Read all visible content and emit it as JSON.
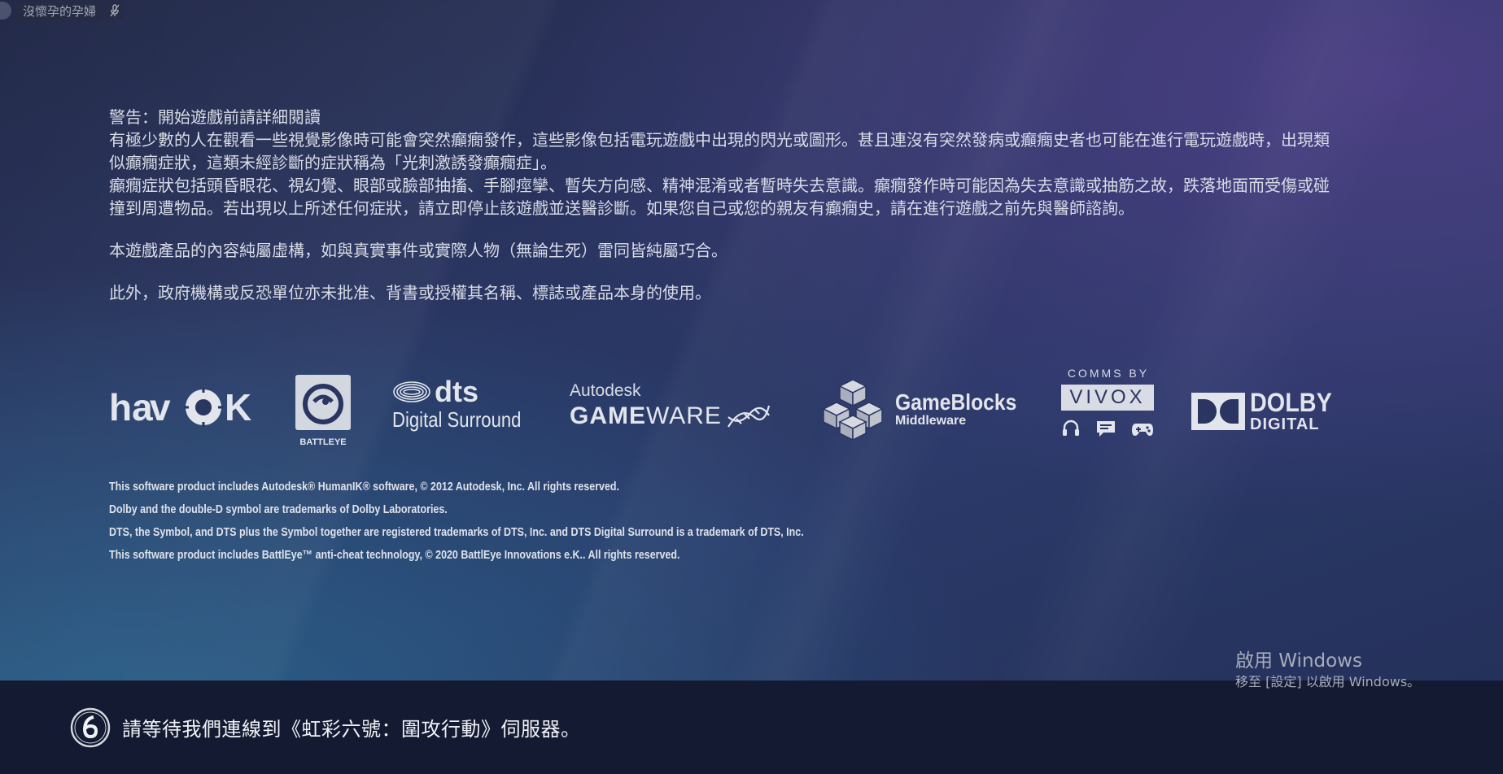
{
  "overlay": {
    "username": "沒懷孕的孕婦",
    "mute_icon": "microphone-muted-icon"
  },
  "warning": {
    "title": "警告：開始遊戲前請詳細閱讀",
    "para1": "有極少數的人在觀看一些視覺影像時可能會突然癲癇發作，這些影像包括電玩遊戲中出現的閃光或圖形。甚且連沒有突然發病或癲癇史者也可能在進行電玩遊戲時，出現類似癲癇症狀，這類未經診斷的症狀稱為「光刺激誘發癲癇症」。",
    "para2": "癲癇症狀包括頭昏眼花、視幻覺、眼部或臉部抽搐、手腳痙攣、暫失方向感、精神混淆或者暫時失去意識。癲癇發作時可能因為失去意識或抽筋之故，跌落地面而受傷或碰撞到周遭物品。若出現以上所述任何症狀，請立即停止該遊戲並送醫診斷。如果您自己或您的親友有癲癇史，請在進行遊戲之前先與醫師諮詢。",
    "para3": "本遊戲產品的內容純屬虛構，如與真實事件或實際人物（無論生死）雷同皆純屬巧合。",
    "para4": "此外，政府機構或反恐單位亦未批准、背書或授權其名稱、標誌或產品本身的使用。"
  },
  "logos": {
    "havok": "havok",
    "battleye": "BATTLEYE",
    "dts_brand": "dts",
    "dts_sub": "Digital Surround",
    "autodesk_top": "Autodesk",
    "autodesk_main_a": "GAME",
    "autodesk_main_b": "WARE",
    "gameblocks_main": "GameBlocks",
    "gameblocks_sub": "Middleware",
    "vivox_top": "COMMS BY",
    "vivox_main": "VIVOX",
    "dolby_main": "DOLBY",
    "dolby_sub": "DIGITAL"
  },
  "legal": [
    "This software product includes Autodesk® HumanIK® software, © 2012 Autodesk, Inc. All rights reserved.",
    "Dolby and the double-D symbol are trademarks of Dolby Laboratories.",
    "DTS, the Symbol, and DTS plus the Symbol together are registered trademarks of DTS, Inc. and DTS Digital Surround is a trademark of DTS, Inc.",
    "This software product includes BattlEye™ anti-cheat technology, © 2020 BattlEye Innovations e.K.. All rights reserved."
  ],
  "windows_activation": {
    "title": "啟用 Windows",
    "subtitle": "移至 [設定] 以啟用 Windows。"
  },
  "status": {
    "icon": "rainbow-six-logo-icon",
    "message": "請等待我們連線到《虹彩六號：圍攻行動》伺服器。"
  }
}
